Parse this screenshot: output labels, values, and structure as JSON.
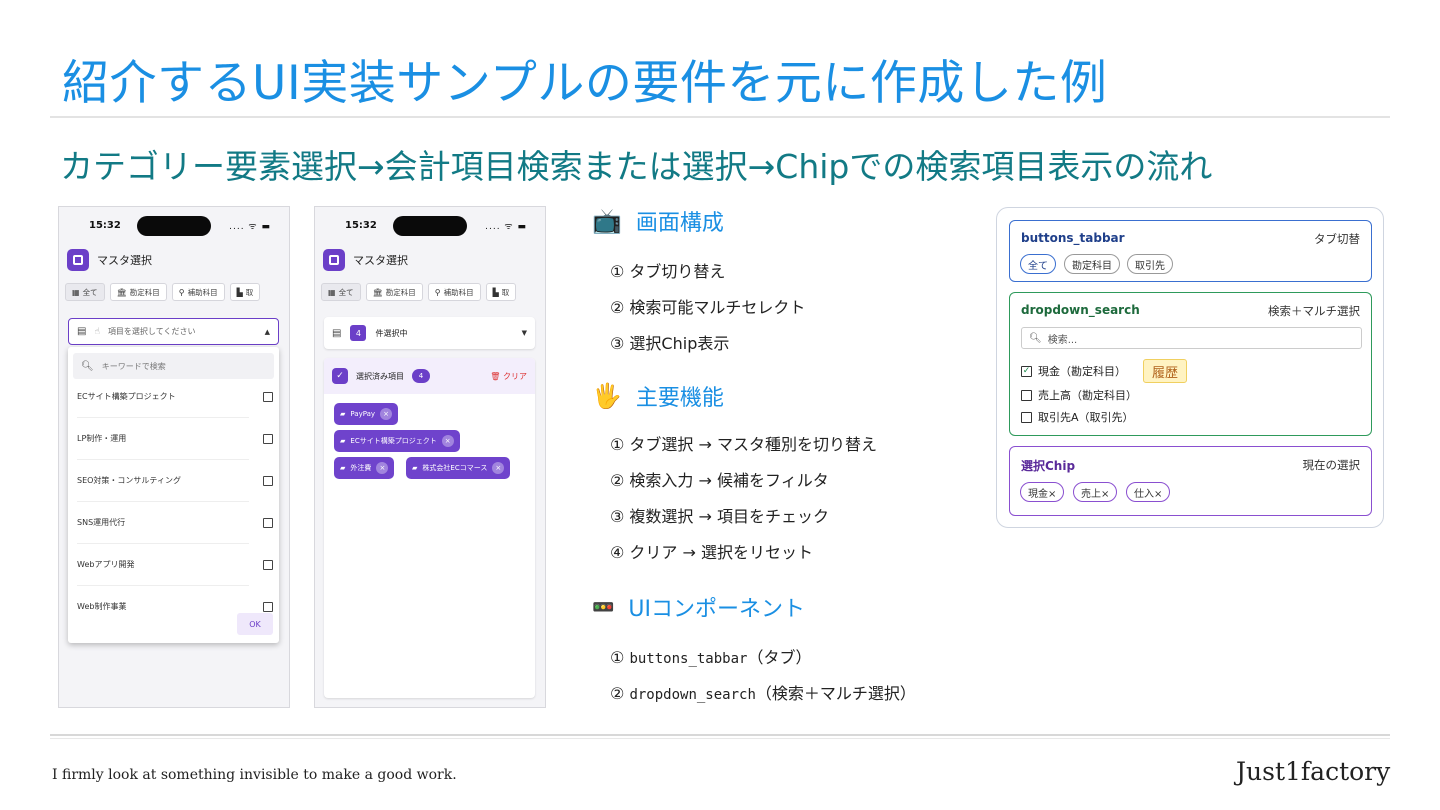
{
  "slide": {
    "title": "紹介するUI実装サンプルの要件を元に作成した例",
    "subtitle": "カテゴリー要素選択→会計項目検索または選択→Chipでの検索項目表示の流れ",
    "footer_tagline": "I firmly look at something invisible to make a good work.",
    "footer_brand": "Just1factory"
  },
  "phone1": {
    "time": "15:32",
    "status_icons": ".... ᯤ ▬",
    "app_title": "マスタ選択",
    "tabs": [
      {
        "icon": "grid-icon",
        "glyph": "▦",
        "label": "全て"
      },
      {
        "icon": "bank-icon",
        "glyph": "🏛",
        "label": "勘定科目"
      },
      {
        "icon": "tree-icon",
        "glyph": "⚲",
        "label": "補助科目"
      },
      {
        "icon": "building-icon",
        "glyph": "▙",
        "label": "取"
      }
    ],
    "dropdown_placeholder": "項目を選択してください",
    "search_placeholder": "キーワードで検索",
    "items": [
      "ECサイト構築プロジェクト",
      "LP制作・運用",
      "SEO対策・コンサルティング",
      "SNS運用代行",
      "Webアプリ開発",
      "Web制作事業"
    ],
    "ok_label": "OK"
  },
  "phone2": {
    "time": "15:32",
    "status_icons": ".... ᯤ ▬",
    "app_title": "マスタ選択",
    "tabs": [
      {
        "icon": "grid-icon",
        "glyph": "▦",
        "label": "全て"
      },
      {
        "icon": "bank-icon",
        "glyph": "🏛",
        "label": "勘定科目"
      },
      {
        "icon": "tree-icon",
        "glyph": "⚲",
        "label": "補助科目"
      },
      {
        "icon": "building-icon",
        "glyph": "▙",
        "label": "取"
      }
    ],
    "selected_count": "4",
    "selected_label": "件選択中",
    "chips_header": "選択済み項目",
    "chips_count": "4",
    "clear_label": "クリア",
    "chips": [
      "PayPay",
      "ECサイト構築プロジェクト",
      "外注費",
      "株式会社ECコマース"
    ]
  },
  "middle": {
    "sec1_title": "画面構成",
    "sec1_items": [
      "① タブ切り替え",
      "② 検索可能マルチセレクト",
      "③ 選択Chip表示"
    ],
    "sec2_title": "主要機能",
    "sec2_items": [
      "① タブ選択 → マスタ種別を切り替え",
      "② 検索入力 → 候補をフィルタ",
      "③ 複数選択 → 項目をチェック",
      "④ クリア → 選択をリセット"
    ],
    "sec3_title": "UIコンポーネント",
    "sec3_items": [
      {
        "num": "①",
        "code": "buttons_tabbar",
        "note": "（タブ）"
      },
      {
        "num": "②",
        "code": "dropdown_search",
        "note": "（検索＋マルチ選択）"
      }
    ]
  },
  "right": {
    "card1": {
      "title": "buttons_tabbar",
      "right": "タブ切替",
      "pills": [
        "全て",
        "勘定科目",
        "取引先"
      ],
      "color": "#3a6fd0"
    },
    "card2": {
      "title": "dropdown_search",
      "right": "検索＋マルチ選択",
      "search": "検索...",
      "items": [
        "現金（勘定科目）",
        "売上高（勘定科目）",
        "取引先A（取引先）"
      ],
      "history": "履歴",
      "color": "#2e9a5b"
    },
    "card3": {
      "title": "選択Chip",
      "right": "現在の選択",
      "pills": [
        "現金×",
        "売上×",
        "仕入×"
      ],
      "color": "#8a4fd0"
    }
  }
}
